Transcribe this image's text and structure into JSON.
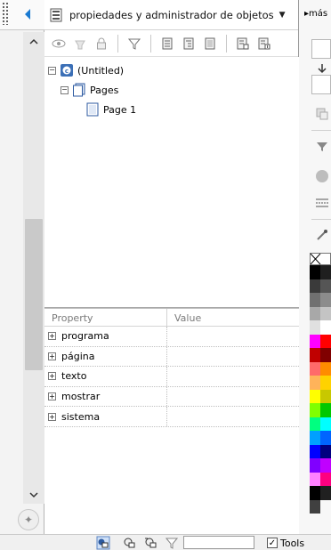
{
  "window": {
    "title": "propiedades y administrador de objetos",
    "title_dropdown_icon": "chevron-down-icon"
  },
  "right_panel": {
    "more_label": "▸más"
  },
  "toolbar": {
    "buttons": [
      "eye-icon",
      "printer-icon",
      "lock-icon",
      "filter-icon",
      "list-view-icon",
      "tree-view-icon",
      "document-view-icon",
      "collapse-icon",
      "expand-icon"
    ]
  },
  "tree": {
    "root_label": "(Untitled)",
    "pages_label": "Pages",
    "page1_label": "Page 1"
  },
  "properties": {
    "col_property": "Property",
    "col_value": "Value",
    "rows": [
      {
        "name": "programa"
      },
      {
        "name": "página"
      },
      {
        "name": "texto"
      },
      {
        "name": "mostrar"
      },
      {
        "name": "sistema"
      }
    ]
  },
  "statusbar": {
    "tools_label": "Tools",
    "tools_checked": true
  },
  "colors": {
    "accent": "#1a7ad1",
    "palette": [
      "#000000",
      "#1f1f1f",
      "#3a3a3a",
      "#555555",
      "#707070",
      "#8c8c8c",
      "#a8a8a8",
      "#c4c4c4",
      "#e0e0e0",
      "#ffffff",
      "#ff00ff",
      "#ff0000",
      "#c00000",
      "#800000",
      "#ff6a6a",
      "#ff8c00",
      "#ffb35a",
      "#ffd200",
      "#ffff00",
      "#c8c800",
      "#80ff00",
      "#00c800",
      "#00ff80",
      "#00ffff",
      "#00a0ff",
      "#0064ff",
      "#0000ff",
      "#000080",
      "#8000ff",
      "#c000ff",
      "#ff80ff",
      "#ff0080",
      "#000000",
      "#202020",
      "#404040"
    ]
  }
}
